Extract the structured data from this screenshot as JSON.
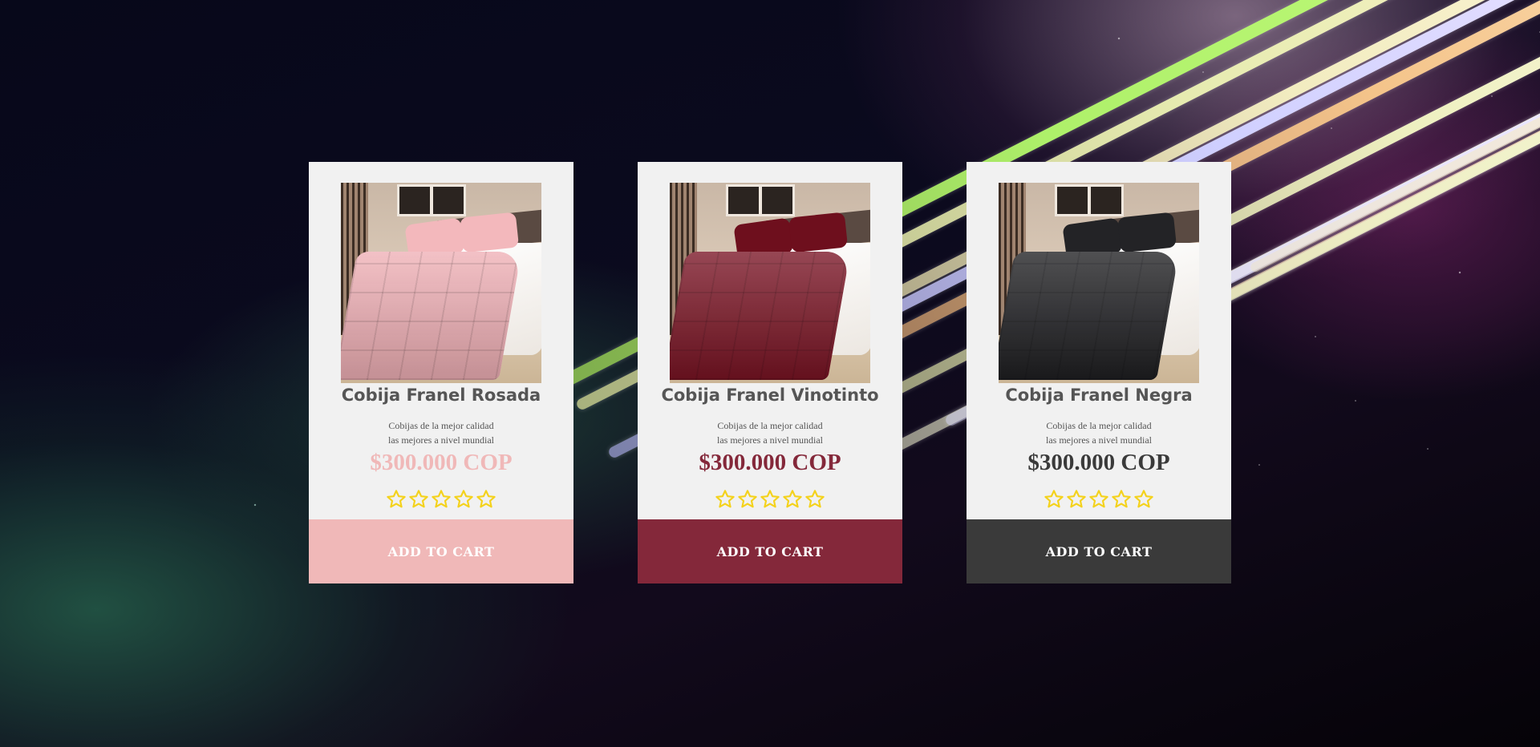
{
  "products": [
    {
      "title": "Cobija Franel Rosada",
      "description_line1": "Cobijas de la mejor calidad",
      "description_line2": "las mejores a nivel mundial",
      "price": "$300.000 COP",
      "rating": 0,
      "rating_max": 5,
      "button_label": "ADD TO CART",
      "accent_color": "#f0b8b8",
      "comforter_color": "#f0b0b6",
      "pillow_color": "#f3b8bc",
      "image_icon": "pink-bed-photo"
    },
    {
      "title": "Cobija Franel Vinotinto",
      "description_line1": "Cobijas de la mejor calidad",
      "description_line2": "las mejores a nivel mundial",
      "price": "$300.000 COP",
      "rating": 0,
      "rating_max": 5,
      "button_label": "ADD TO CART",
      "accent_color": "#84283a",
      "comforter_color": "#7a1424",
      "pillow_color": "#6e0f1d",
      "image_icon": "burgundy-bed-photo"
    },
    {
      "title": "Cobija Franel Negra",
      "description_line1": "Cobijas de la mejor calidad",
      "description_line2": "las mejores a nivel mundial",
      "price": "$300.000 COP",
      "rating": 0,
      "rating_max": 5,
      "button_label": "ADD TO CART",
      "accent_color": "#3a3a3a",
      "comforter_color": "#1f1f22",
      "pillow_color": "#232326",
      "image_icon": "black-bed-photo"
    }
  ],
  "colors": {
    "card_background": "#f1f1f1",
    "title_text": "#555555",
    "star_outline": "#f4d21c",
    "button_text": "#ffffff"
  }
}
